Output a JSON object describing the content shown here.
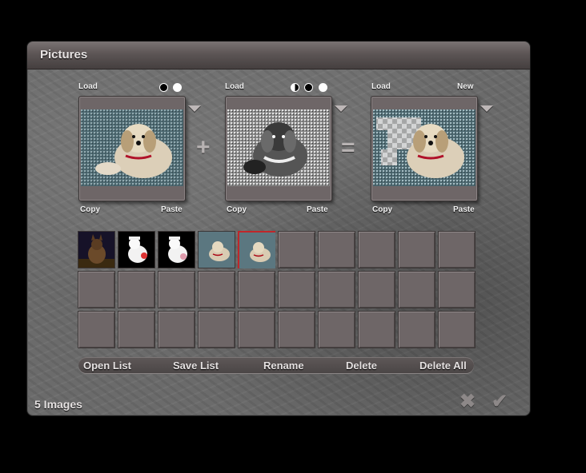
{
  "dialog": {
    "title": "Pictures",
    "status": "5 Images"
  },
  "slots": {
    "source1": {
      "load_label": "Load",
      "copy_label": "Copy",
      "paste_label": "Paste"
    },
    "source2": {
      "load_label": "Load",
      "copy_label": "Copy",
      "paste_label": "Paste"
    },
    "result": {
      "load_label": "Load",
      "new_label": "New",
      "copy_label": "Copy",
      "paste_label": "Paste"
    }
  },
  "operators": {
    "plus": "+",
    "equals": "="
  },
  "list": {
    "total_cells": 30,
    "image_count": 5,
    "selected_index": 4
  },
  "toolbar": {
    "open_list": "Open List",
    "save_list": "Save List",
    "rename": "Rename",
    "delete": "Delete",
    "delete_all": "Delete All"
  },
  "actions": {
    "cancel_icon": "x-icon",
    "ok_icon": "check-icon"
  },
  "colors": {
    "selected_border": "#c0262a",
    "cell_fill": "#6e6667"
  }
}
